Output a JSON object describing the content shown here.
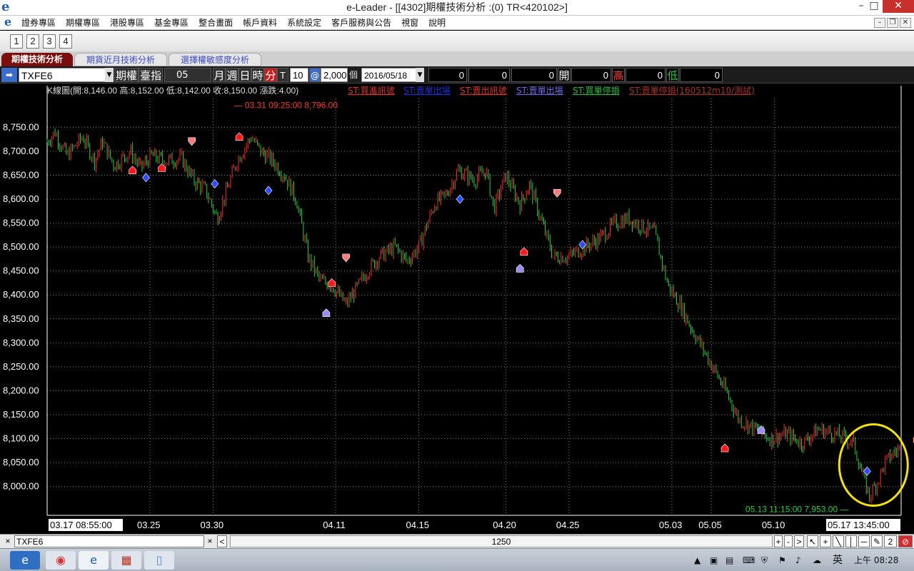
{
  "window": {
    "title": "e-Leader - [[4302]期權技術分析 :(0) TR<420102>]",
    "logo": "e",
    "min_label": "–",
    "max_label": "□",
    "close_label": "✕"
  },
  "menu": {
    "items": [
      "證券專區",
      "期權專區",
      "港股專區",
      "基金專區",
      "整合畫面",
      "帳戶資料",
      "系統設定",
      "客戶服務與公告",
      "視窗",
      "說明"
    ],
    "mdi_min": "–",
    "mdi_restore": "❐",
    "mdi_close": "✕"
  },
  "workspace": {
    "buttons": [
      "1",
      "2",
      "3",
      "4"
    ]
  },
  "tabs": [
    "期權技術分析",
    "期貨近月技術分析",
    "選擇權敏感度分析"
  ],
  "toolbar": {
    "symbol": "TXFE6",
    "mode1": "期權",
    "mode2": "臺指",
    "month": "05",
    "period_month": "月",
    "period_week": "週",
    "period_day": "日",
    "period_hour": "時",
    "period_minute": "分",
    "period_tick": "T",
    "interval": "10",
    "at_label": "@",
    "count": "2,000",
    "count_unit": "個",
    "date": "2016/05/18",
    "r1": "0",
    "r2": "0",
    "r3": "0",
    "open_label": "開",
    "open_value": "0",
    "high_label": "高",
    "high_value": "0",
    "low_label": "低",
    "low_value": "0"
  },
  "chart_header": {
    "kline_info": "K線圖(開:8,146.00 高:8,152.00 低:8,142.00 收:8,150.00 漲跌:4.00)",
    "legend": [
      {
        "label": "ST:買進訊號",
        "color": "#e0302c"
      },
      {
        "label": "ST:賣單出場",
        "color": "#1b2fd8"
      },
      {
        "label": "ST:賣出訊號",
        "color": "#e0302c"
      },
      {
        "label": "ST:賣單出場",
        "color": "#6a6ae8"
      },
      {
        "label": "ST:買單停損",
        "color": "#1fbf3a"
      },
      {
        "label": "ST:賣單停損(160512m10/測試)",
        "color": "#a83222"
      }
    ]
  },
  "chart_data": {
    "type": "candlestick",
    "ylim": [
      7940,
      8810
    ],
    "y_ticks": [
      8000,
      8050,
      8100,
      8150,
      8200,
      8250,
      8300,
      8350,
      8400,
      8450,
      8500,
      8550,
      8600,
      8650,
      8700,
      8750
    ],
    "y_tick_labels": [
      "8,000.00",
      "8,050.00",
      "8,100.00",
      "8,150.00",
      "8,200.00",
      "8,250.00",
      "8,300.00",
      "8,350.00",
      "8,400.00",
      "8,450.00",
      "8,500.00",
      "8,550.00",
      "8,600.00",
      "8,650.00",
      "8,700.00",
      "8,750.00"
    ],
    "x_start_label": "03.17 08:55:00",
    "x_end_label": "05.17 13:45:00",
    "x_labels": [
      "03.25",
      "03.30",
      "04.11",
      "04.15",
      "04.20",
      "04.25",
      "05.03",
      "05.05",
      "05.10"
    ],
    "x_label_index": [
      130,
      210,
      365,
      470,
      580,
      660,
      790,
      840,
      920
    ],
    "x_count": 1080,
    "close_path": [
      [
        0,
        8720
      ],
      [
        10,
        8740
      ],
      [
        25,
        8690
      ],
      [
        45,
        8730
      ],
      [
        60,
        8680
      ],
      [
        70,
        8720
      ],
      [
        85,
        8670
      ],
      [
        105,
        8700
      ],
      [
        118,
        8665
      ],
      [
        132,
        8690
      ],
      [
        150,
        8680
      ],
      [
        170,
        8685
      ],
      [
        185,
        8640
      ],
      [
        200,
        8620
      ],
      [
        215,
        8560
      ],
      [
        240,
        8680
      ],
      [
        258,
        8730
      ],
      [
        270,
        8700
      ],
      [
        285,
        8680
      ],
      [
        300,
        8650
      ],
      [
        315,
        8600
      ],
      [
        330,
        8480
      ],
      [
        345,
        8430
      ],
      [
        360,
        8420
      ],
      [
        378,
        8380
      ],
      [
        390,
        8410
      ],
      [
        405,
        8450
      ],
      [
        420,
        8480
      ],
      [
        440,
        8500
      ],
      [
        455,
        8470
      ],
      [
        470,
        8500
      ],
      [
        490,
        8590
      ],
      [
        505,
        8610
      ],
      [
        520,
        8660
      ],
      [
        540,
        8640
      ],
      [
        555,
        8660
      ],
      [
        565,
        8580
      ],
      [
        580,
        8650
      ],
      [
        598,
        8590
      ],
      [
        610,
        8630
      ],
      [
        640,
        8480
      ],
      [
        660,
        8480
      ],
      [
        680,
        8500
      ],
      [
        700,
        8520
      ],
      [
        718,
        8550
      ],
      [
        735,
        8560
      ],
      [
        755,
        8540
      ],
      [
        768,
        8530
      ],
      [
        785,
        8420
      ],
      [
        800,
        8380
      ],
      [
        815,
        8330
      ],
      [
        835,
        8270
      ],
      [
        858,
        8200
      ],
      [
        875,
        8140
      ],
      [
        895,
        8120
      ],
      [
        915,
        8100
      ],
      [
        935,
        8110
      ],
      [
        955,
        8090
      ],
      [
        975,
        8120
      ],
      [
        995,
        8110
      ],
      [
        1010,
        8100
      ],
      [
        1020,
        8090
      ],
      [
        1030,
        8030
      ],
      [
        1040,
        7980
      ],
      [
        1050,
        8010
      ],
      [
        1060,
        8050
      ],
      [
        1070,
        8070
      ],
      [
        1080,
        8080
      ],
      [
        1095,
        8110
      ],
      [
        1110,
        8140
      ]
    ],
    "high_annotation": "03.31 09:25:00  8,796.00",
    "high_point": {
      "x": 238,
      "y": 8796
    },
    "low_annotation": "05.13 11:15:00  7,953.00",
    "low_point": {
      "x": 1042,
      "y": 7953
    },
    "signals": [
      {
        "type": "buy",
        "x": 108,
        "y": 8660
      },
      {
        "type": "sell-exit",
        "x": 125,
        "y": 8645
      },
      {
        "type": "buy",
        "x": 145,
        "y": 8665
      },
      {
        "type": "sell",
        "x": 183,
        "y": 8718
      },
      {
        "type": "sell-exit",
        "x": 212,
        "y": 8632
      },
      {
        "type": "buy",
        "x": 243,
        "y": 8730
      },
      {
        "type": "sell-exit",
        "x": 280,
        "y": 8618
      },
      {
        "type": "sell-exit-light",
        "x": 353,
        "y": 8362
      },
      {
        "type": "sell",
        "x": 378,
        "y": 8475
      },
      {
        "type": "buy",
        "x": 360,
        "y": 8425
      },
      {
        "type": "sell-exit",
        "x": 522,
        "y": 8600
      },
      {
        "type": "sell-exit-light",
        "x": 598,
        "y": 8455
      },
      {
        "type": "buy",
        "x": 603,
        "y": 8490
      },
      {
        "type": "sell",
        "x": 645,
        "y": 8610
      },
      {
        "type": "sell-exit",
        "x": 677,
        "y": 8505
      },
      {
        "type": "buy",
        "x": 857,
        "y": 8080
      },
      {
        "type": "sell-exit-light",
        "x": 903,
        "y": 8118
      },
      {
        "type": "sell-exit",
        "x": 1037,
        "y": 8032
      },
      {
        "type": "buy",
        "x": 1100,
        "y": 8100
      }
    ],
    "highlight": {
      "x": 1045,
      "y": 8045,
      "label": "circle"
    },
    "colors": {
      "up": "#ff2a2a",
      "down": "#1fd43a",
      "grid": "#7a7a7a",
      "axis": "#ffffff"
    }
  },
  "bottom": {
    "symbol": "TXFE6",
    "close1": "×",
    "close2": "×",
    "scroll_left": "<",
    "bars_label": "1250",
    "scroll_right": ">",
    "zoom_in": "+",
    "zoom_out": "-",
    "bar_indicator": "||"
  },
  "taskbar": {
    "apps": [
      "ie-icon",
      "chrome-icon",
      "eleader-icon",
      "calendar-icon",
      "notepad-icon"
    ],
    "ime": "英",
    "time": "上午 08:28"
  }
}
